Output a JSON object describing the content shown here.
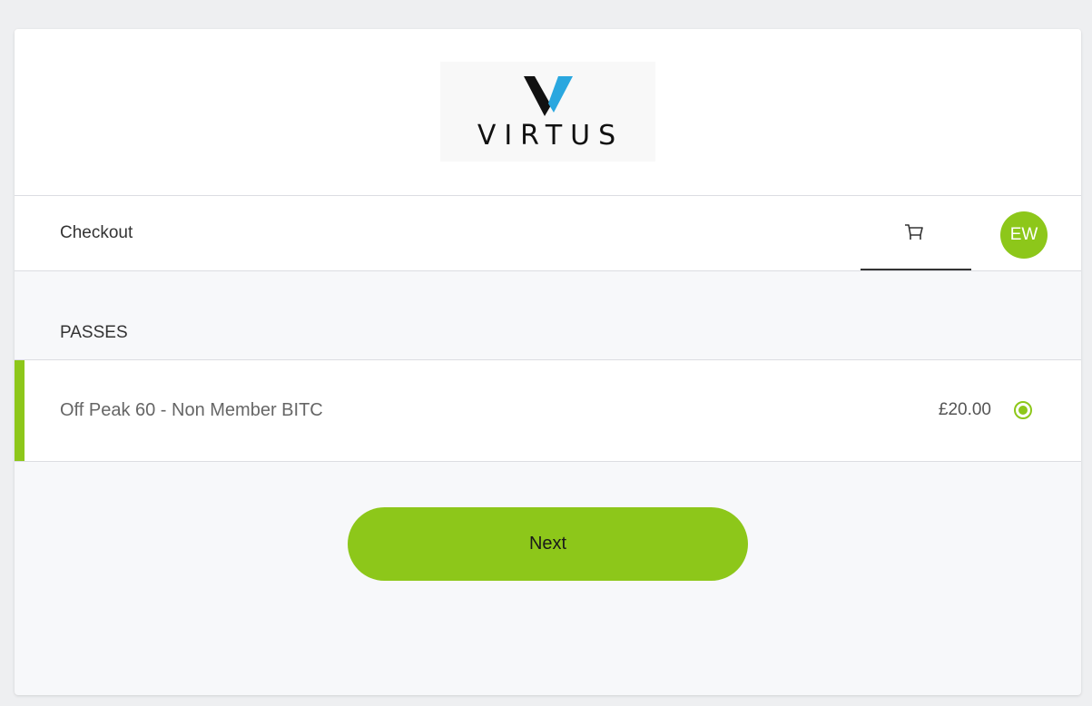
{
  "brand": {
    "logo_text": "VIRTUS",
    "logo_dark_color": "#111111",
    "logo_accent_color": "#2aa7df",
    "accent_color": "#8dc71a"
  },
  "header": {
    "title": "Checkout",
    "cart_icon": "shopping-cart-icon",
    "user_initials": "EW"
  },
  "passes": {
    "section_label": "PASSES",
    "items": [
      {
        "name": "Off Peak 60 - Non Member BITC",
        "price": "£20.00",
        "selected": true
      }
    ]
  },
  "actions": {
    "next_label": "Next"
  }
}
